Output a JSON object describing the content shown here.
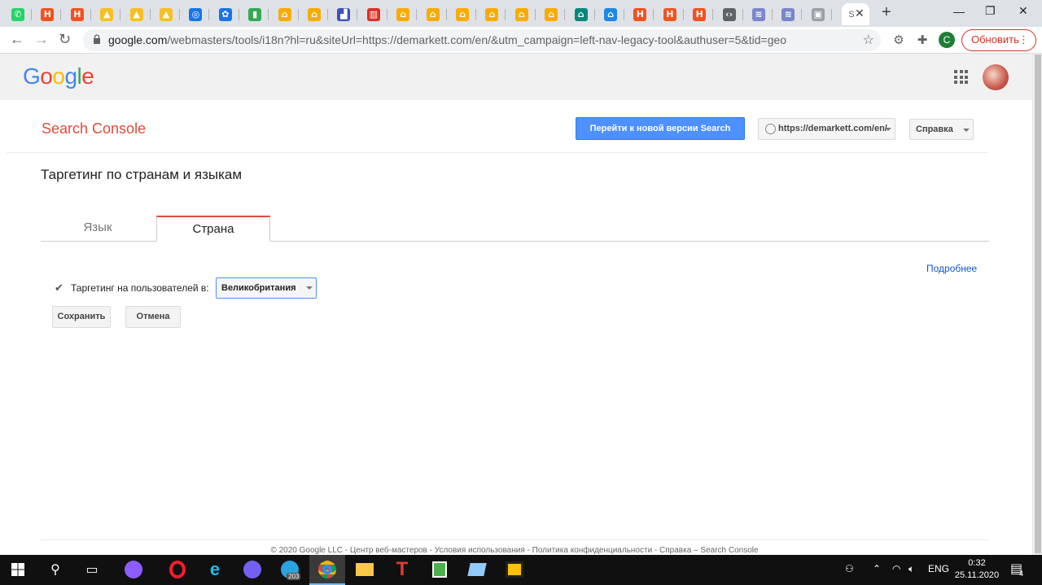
{
  "browser": {
    "tabs": [
      {
        "icon": "whatsapp-icon",
        "glyph": "✆",
        "bg": "#25d366"
      },
      {
        "icon": "h-icon",
        "glyph": "H",
        "bg": "#f4511e"
      },
      {
        "icon": "h-icon",
        "glyph": "H",
        "bg": "#f4511e"
      },
      {
        "icon": "pma-icon",
        "glyph": "▲",
        "bg": "#f6bf26"
      },
      {
        "icon": "pma-icon",
        "glyph": "▲",
        "bg": "#f6bf26"
      },
      {
        "icon": "pma-icon",
        "glyph": "▲",
        "bg": "#f6bf26"
      },
      {
        "icon": "compass-icon",
        "glyph": "◎",
        "bg": "#1a73e8"
      },
      {
        "icon": "gear-icon",
        "glyph": "✿",
        "bg": "#1a73e8"
      },
      {
        "icon": "bar-icon",
        "glyph": "▮",
        "bg": "#34a853"
      },
      {
        "icon": "home-icon",
        "glyph": "⌂",
        "bg": "#f9ab00"
      },
      {
        "icon": "home-icon",
        "glyph": "⌂",
        "bg": "#f9ab00"
      },
      {
        "icon": "chart-icon",
        "glyph": "▟",
        "bg": "#3f51b5"
      },
      {
        "icon": "bars-icon",
        "glyph": "▥",
        "bg": "#d93025"
      },
      {
        "icon": "home-icon",
        "glyph": "⌂",
        "bg": "#f9ab00"
      },
      {
        "icon": "home-icon",
        "glyph": "⌂",
        "bg": "#f9ab00"
      },
      {
        "icon": "home-icon",
        "glyph": "⌂",
        "bg": "#f9ab00"
      },
      {
        "icon": "home-icon",
        "glyph": "⌂",
        "bg": "#f9ab00"
      },
      {
        "icon": "home-icon",
        "glyph": "⌂",
        "bg": "#f9ab00"
      },
      {
        "icon": "home-icon",
        "glyph": "⌂",
        "bg": "#f9ab00"
      },
      {
        "icon": "house-teal-icon",
        "glyph": "⌂",
        "bg": "#00897b"
      },
      {
        "icon": "house-teal-icon",
        "glyph": "⌂",
        "bg": "#1e88e5"
      },
      {
        "icon": "h-icon",
        "glyph": "H",
        "bg": "#f4511e"
      },
      {
        "icon": "h-icon",
        "glyph": "H",
        "bg": "#f4511e"
      },
      {
        "icon": "h-icon",
        "glyph": "H",
        "bg": "#f4511e"
      },
      {
        "icon": "code-icon",
        "glyph": "‹›",
        "bg": "#5f6368"
      },
      {
        "icon": "wifi-icon",
        "glyph": "≋",
        "bg": "#7986cb"
      },
      {
        "icon": "wifi-icon",
        "glyph": "≋",
        "bg": "#7986cb"
      },
      {
        "icon": "cart-icon",
        "glyph": "▣",
        "bg": "#9aa0a6"
      }
    ],
    "active_tab_glyph": "S",
    "close_glyph": "✕",
    "url_host": "google.com",
    "url_rest": "/webmasters/tools/i18n?hl=ru&siteUrl=https://demarkett.com/en/&utm_campaign=left-nav-legacy-tool&authuser=5&tid=geo",
    "profile_letter": "C",
    "update_label": "Обновить"
  },
  "google_logo": "Google",
  "header": {
    "product": "Search Console",
    "new_version_label": "Перейти к новой версии Search Console",
    "site_label": "https://demarkett.com/en/",
    "help_label": "Справка"
  },
  "page": {
    "title": "Таргетинг по странам и языкам",
    "tabs": [
      {
        "label": "Язык",
        "selected": false
      },
      {
        "label": "Страна",
        "selected": true
      }
    ],
    "more_link": "Подробнее",
    "targeting_label": "Таргетинг на пользователей в:",
    "targeting_checked": true,
    "country_value": "Великобритания",
    "save_label": "Сохранить",
    "cancel_label": "Отмена"
  },
  "footer": "© 2020 Google LLC - Центр веб-мастеров - Условия использования - Политика конфиденциальности - Справка – Search Console",
  "taskbar": {
    "telegram_badge": "203",
    "lang": "ENG",
    "time": "0:32",
    "date": "25.11.2020",
    "notifications": "4"
  }
}
